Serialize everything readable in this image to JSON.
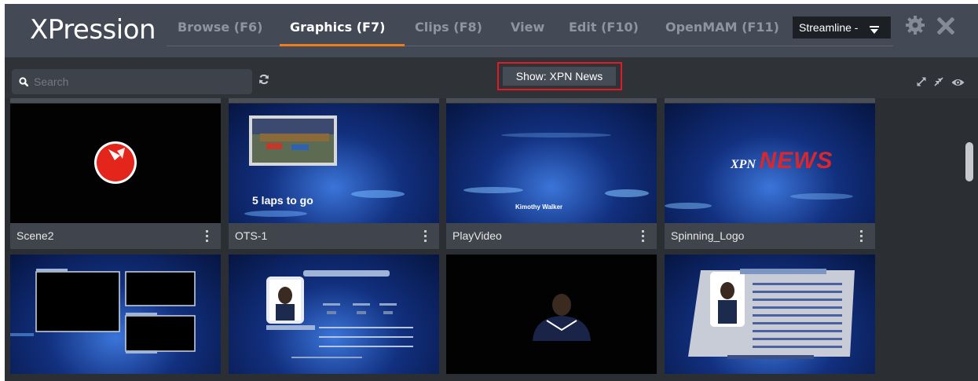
{
  "app": {
    "logo": "XPression"
  },
  "tabs": [
    {
      "label": "Browse (F6)",
      "active": false
    },
    {
      "label": "Graphics (F7)",
      "active": true
    },
    {
      "label": "Clips (F8)",
      "active": false
    },
    {
      "label": "View",
      "active": false
    },
    {
      "label": "Edit (F10)",
      "active": false
    },
    {
      "label": "OpenMAM (F11)",
      "active": false
    }
  ],
  "mode_select": {
    "value": "Streamline -"
  },
  "header_icons": [
    "gear-icon",
    "close-icon"
  ],
  "toolbar": {
    "search_placeholder": "Search",
    "show_label": "Show: XPN News",
    "right_icons": [
      "expand-icon",
      "collapse-icon",
      "eye-icon"
    ]
  },
  "accent_color": "#f07d1c",
  "highlight_color": "#e11b22",
  "cards": [
    {
      "name": "Scene2",
      "thumb": "black"
    },
    {
      "name": "OTS-1",
      "thumb": "blue",
      "overlay_text": "5 laps to go"
    },
    {
      "name": "PlayVideo",
      "thumb": "blue",
      "overlay_text": "Kimothy Walker"
    },
    {
      "name": "Spinning_Logo",
      "thumb": "blue",
      "overlay_text_a": "XPN",
      "overlay_text_b": "NEWS"
    },
    {
      "name": "",
      "thumb": "blue"
    },
    {
      "name": "",
      "thumb": "blue"
    },
    {
      "name": "",
      "thumb": "black"
    },
    {
      "name": "",
      "thumb": "blue"
    }
  ]
}
